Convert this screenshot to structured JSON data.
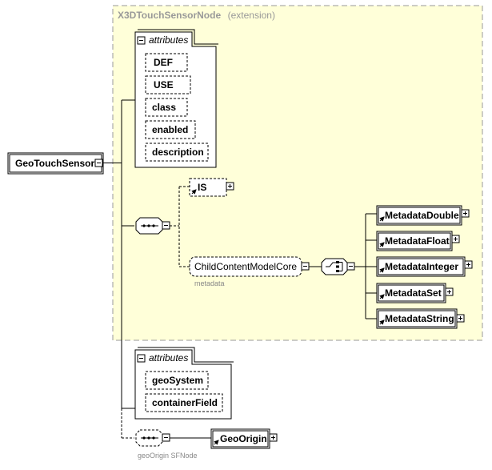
{
  "extension_box": {
    "name": "X3DTouchSensorNode",
    "suffix": "(extension)"
  },
  "root": {
    "label": "GeoTouchSensor"
  },
  "attributes_top": {
    "title": "attributes",
    "items": [
      "DEF",
      "USE",
      "class",
      "enabled",
      "description"
    ]
  },
  "choice": {
    "is_label": "IS",
    "child_content": "ChildContentModelCore",
    "child_content_sub": "metadata"
  },
  "metadata_items": [
    "MetadataDouble",
    "MetadataFloat",
    "MetadataInteger",
    "MetadataSet",
    "MetadataString"
  ],
  "attributes_bottom": {
    "title": "attributes",
    "items": [
      "geoSystem",
      "containerField"
    ]
  },
  "geo_origin": {
    "label": "GeoOrigin",
    "sub": "geoOrigin SFNode"
  },
  "colors": {
    "extension_fill": "#ffffd9",
    "extension_border": "#999999"
  }
}
